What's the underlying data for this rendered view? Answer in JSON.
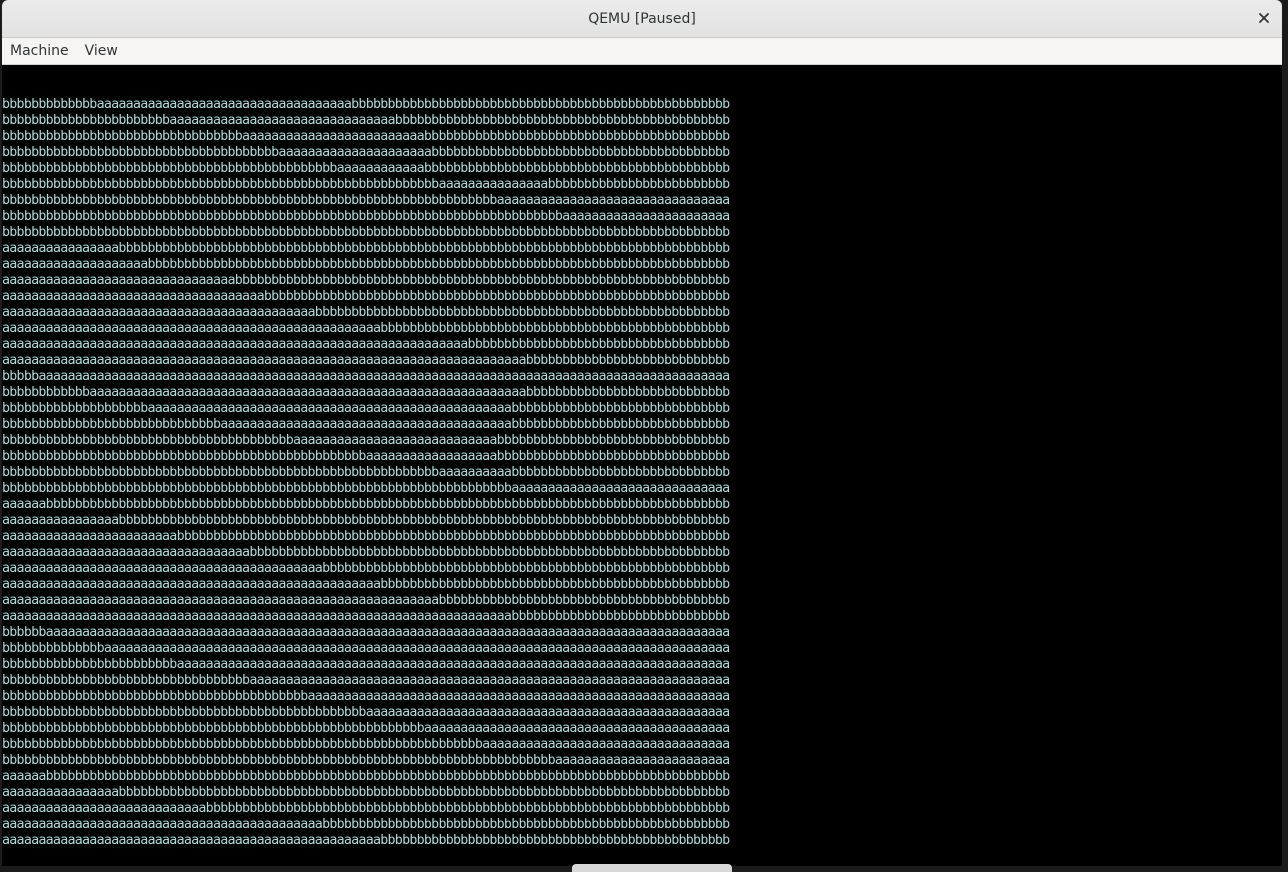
{
  "window": {
    "title": "QEMU [Paused]",
    "close_icon": "close-icon"
  },
  "menubar": {
    "items": [
      {
        "label": "Machine"
      },
      {
        "label": "View"
      }
    ]
  },
  "console": {
    "text_color": "#a6ddd9",
    "background": "#000000",
    "rows": [
      {
        "b": 13,
        "a": 35,
        "b2": 32
      },
      {
        "b": 23,
        "a": 31,
        "b2": 26
      },
      {
        "b": 33,
        "a": 25,
        "b2": 22
      },
      {
        "b": 38,
        "a": 21,
        "b2": 21
      },
      {
        "b": 46,
        "a": 12,
        "b2": 22
      },
      {
        "b": 60,
        "a": 15,
        "b2": 5
      },
      {
        "b": 68,
        "a": 12,
        "b2": 0
      },
      {
        "b": 77,
        "a": 3,
        "b2": 0
      },
      {
        "a": 0,
        "b": 80
      },
      {
        "a": 16,
        "b": 64
      },
      {
        "a": 20,
        "b": 60
      },
      {
        "a": 32,
        "b": 48
      },
      {
        "a": 36,
        "b": 44
      },
      {
        "a": 43,
        "b": 37
      },
      {
        "a": 52,
        "b": 28
      },
      {
        "a": 64,
        "b": 16
      },
      {
        "a": 72,
        "b": 8
      },
      {
        "b": 5,
        "a": 75
      },
      {
        "b": 12,
        "a": 60,
        "b2": 8
      },
      {
        "b": 20,
        "a": 50,
        "b2": 10
      },
      {
        "b": 30,
        "a": 40,
        "b2": 10
      },
      {
        "b": 40,
        "a": 28,
        "b2": 12
      },
      {
        "b": 50,
        "a": 18,
        "b2": 12
      },
      {
        "b": 60,
        "a": 10,
        "b2": 10
      },
      {
        "b": 70,
        "a": 10,
        "b2": 0
      },
      {
        "a": 6,
        "b": 74
      },
      {
        "a": 16,
        "b": 64
      },
      {
        "a": 24,
        "b": 56
      },
      {
        "a": 34,
        "b": 46
      },
      {
        "a": 44,
        "b": 36
      },
      {
        "a": 52,
        "b": 28
      },
      {
        "a": 60,
        "b": 20
      },
      {
        "a": 70,
        "b": 10
      },
      {
        "b": 6,
        "a": 74
      },
      {
        "b": 14,
        "a": 66
      },
      {
        "b": 24,
        "a": 56
      },
      {
        "b": 34,
        "a": 46
      },
      {
        "b": 42,
        "a": 38
      },
      {
        "b": 50,
        "a": 30
      },
      {
        "b": 58,
        "a": 22
      },
      {
        "b": 66,
        "a": 14
      },
      {
        "b": 76,
        "a": 4
      },
      {
        "a": 6,
        "b": 74
      },
      {
        "a": 16,
        "b": 64
      },
      {
        "a": 28,
        "b": 52
      },
      {
        "a": 44,
        "b": 36
      },
      {
        "a": 52,
        "b": 28
      }
    ]
  }
}
